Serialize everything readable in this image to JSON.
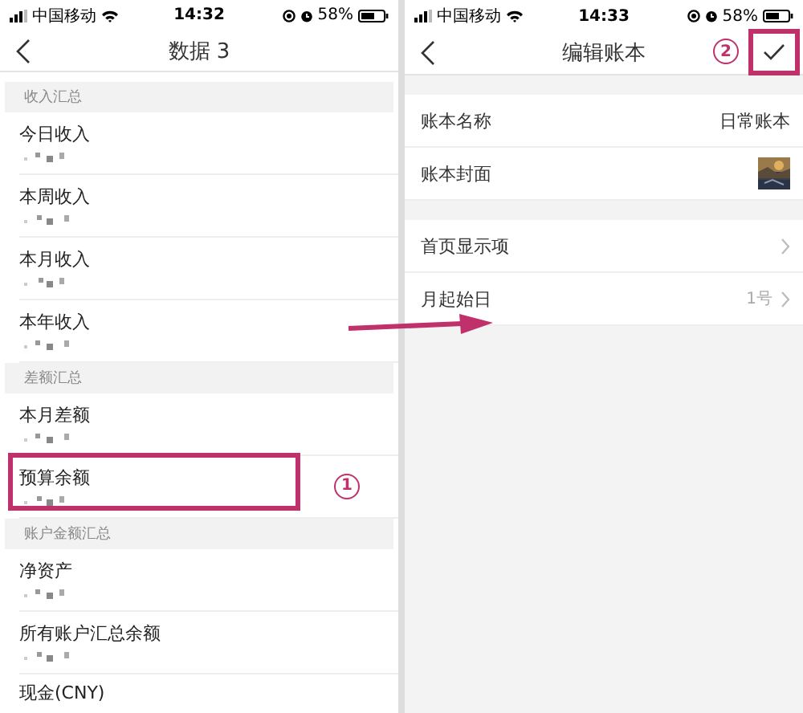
{
  "left_screen": {
    "status_bar": {
      "carrier": "中国移动",
      "time": "14:32",
      "battery": "58%"
    },
    "nav": {
      "title": "数据 3"
    },
    "sections": [
      {
        "header": "收入汇总",
        "rows": [
          {
            "label": "今日收入",
            "highlighted": false
          },
          {
            "label": "本周收入",
            "highlighted": false
          },
          {
            "label": "本月收入",
            "highlighted": false
          },
          {
            "label": "本年收入",
            "highlighted": false
          }
        ]
      },
      {
        "header": "差额汇总",
        "rows": [
          {
            "label": "本月差额",
            "highlighted": false
          },
          {
            "label": "预算余额",
            "highlighted": true,
            "annotation": "1"
          }
        ]
      },
      {
        "header": "账户金额汇总",
        "rows": [
          {
            "label": "净资产",
            "highlighted": false
          },
          {
            "label": "所有账户汇总余额",
            "highlighted": false
          },
          {
            "label": "现金(CNY)",
            "highlighted": false
          }
        ]
      }
    ]
  },
  "right_screen": {
    "status_bar": {
      "carrier": "中国移动",
      "time": "14:33",
      "battery": "58%"
    },
    "nav": {
      "title": "编辑账本",
      "confirm_highlighted": true,
      "annotation": "2"
    },
    "groups": [
      [
        {
          "kind": "value",
          "label": "账本名称",
          "value": "日常账本"
        },
        {
          "kind": "picture",
          "label": "账本封面"
        }
      ],
      [
        {
          "kind": "link",
          "label": "首页显示项"
        },
        {
          "kind": "link",
          "label": "月起始日",
          "value": "1号"
        }
      ]
    ]
  }
}
